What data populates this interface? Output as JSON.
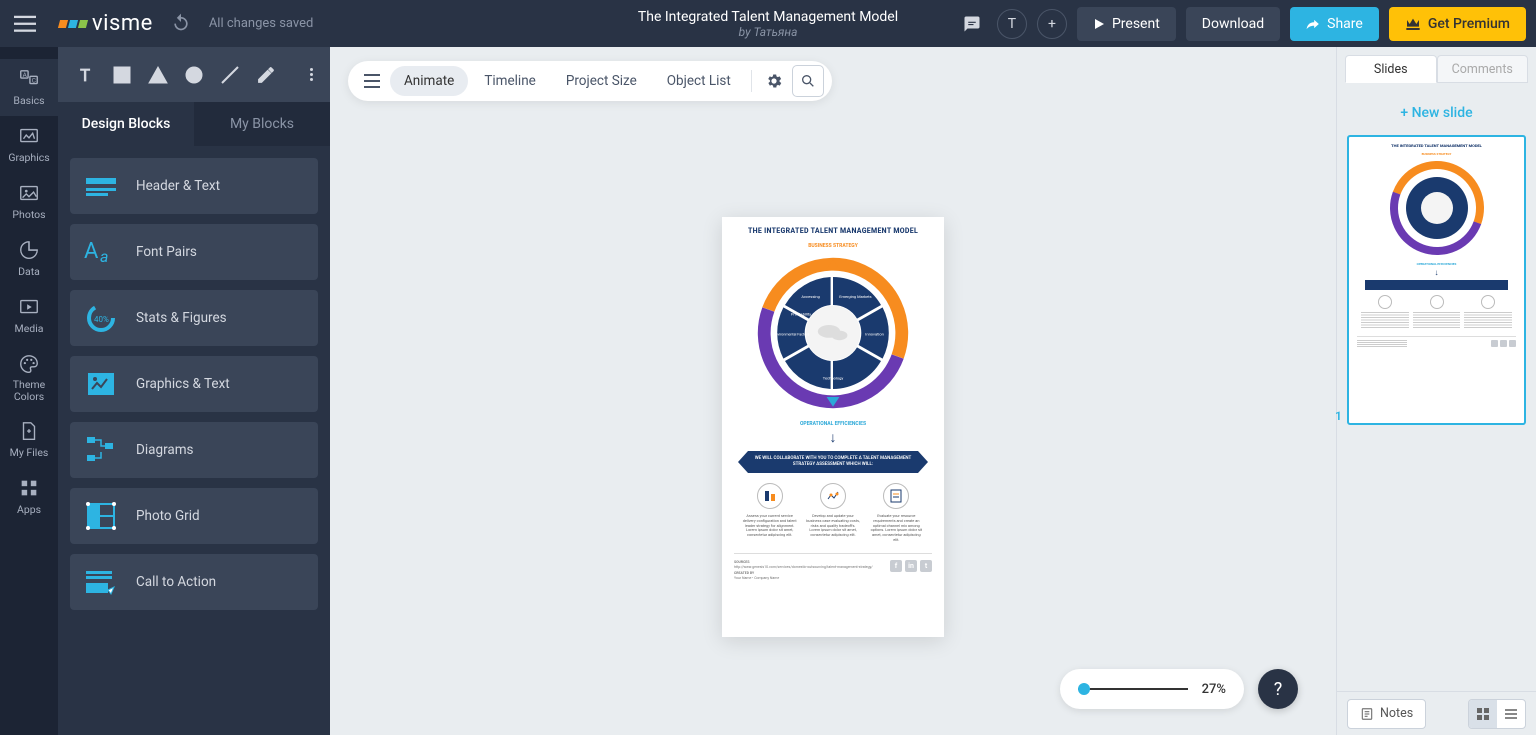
{
  "header": {
    "logo_text": "visme",
    "save_status": "All changes saved",
    "title": "The Integrated Talent Management Model",
    "author": "by Татьяна",
    "user_initial": "T",
    "present": "Present",
    "download": "Download",
    "share": "Share",
    "premium": "Get Premium"
  },
  "rail": {
    "basics": "Basics",
    "graphics": "Graphics",
    "photos": "Photos",
    "data": "Data",
    "media": "Media",
    "theme_colors": "Theme Colors",
    "my_files": "My Files",
    "apps": "Apps"
  },
  "panel": {
    "tab_design": "Design Blocks",
    "tab_my": "My Blocks",
    "items": {
      "header_text": "Header & Text",
      "font_pairs": "Font Pairs",
      "stats_figures": "Stats & Figures",
      "graphics_text": "Graphics & Text",
      "diagrams": "Diagrams",
      "photo_grid": "Photo Grid",
      "call_to_action": "Call to Action"
    }
  },
  "canvas_toolbar": {
    "animate": "Animate",
    "timeline": "Timeline",
    "project_size": "Project Size",
    "object_list": "Object List"
  },
  "zoom": {
    "pct": "27%",
    "help": "?"
  },
  "doc": {
    "title": "THE INTEGRATED TALENT MANAGEMENT MODEL",
    "business_strategy": "BUSINESS STRATEGY",
    "operational": "OPERATIONAL EFFICIENCIES",
    "banner": "WE WILL COLLABORATE WITH YOU TO COMPLETE A TALENT MANAGEMENT STRATEGY ASSESSMENT WHICH WILL:",
    "segments": [
      "Profitability",
      "Emerging Markets",
      "Innovation",
      "Technology",
      "Environmental Factors",
      "Accessing"
    ],
    "col1": "Assess your current service delivery configuration and talent leader strategy for alignment. Lorem ipsum dolor sit amet, consectetur adipiscing elit.",
    "col2": "Develop and update your business case evaluating costs, risks and quality tradeoffs. Lorem ipsum dolor sit amet, consectetur adipiscing elit.",
    "col3": "Evaluate your resource requirements and create an optimal channel mix among options. Lorem ipsum dolor sit amet, consectetur adipiscing elit.",
    "sources_label": "SOURCES",
    "sources_url": "http://www.genesis10.com/services/domestic-outsourcing/talent-management-strategy/",
    "created_label": "CREATED BY",
    "created_by": "Your Name • Company Name"
  },
  "right": {
    "tab_slides": "Slides",
    "tab_comments": "Comments",
    "new_slide": "New slide",
    "slide_num": "1",
    "notes": "Notes"
  }
}
